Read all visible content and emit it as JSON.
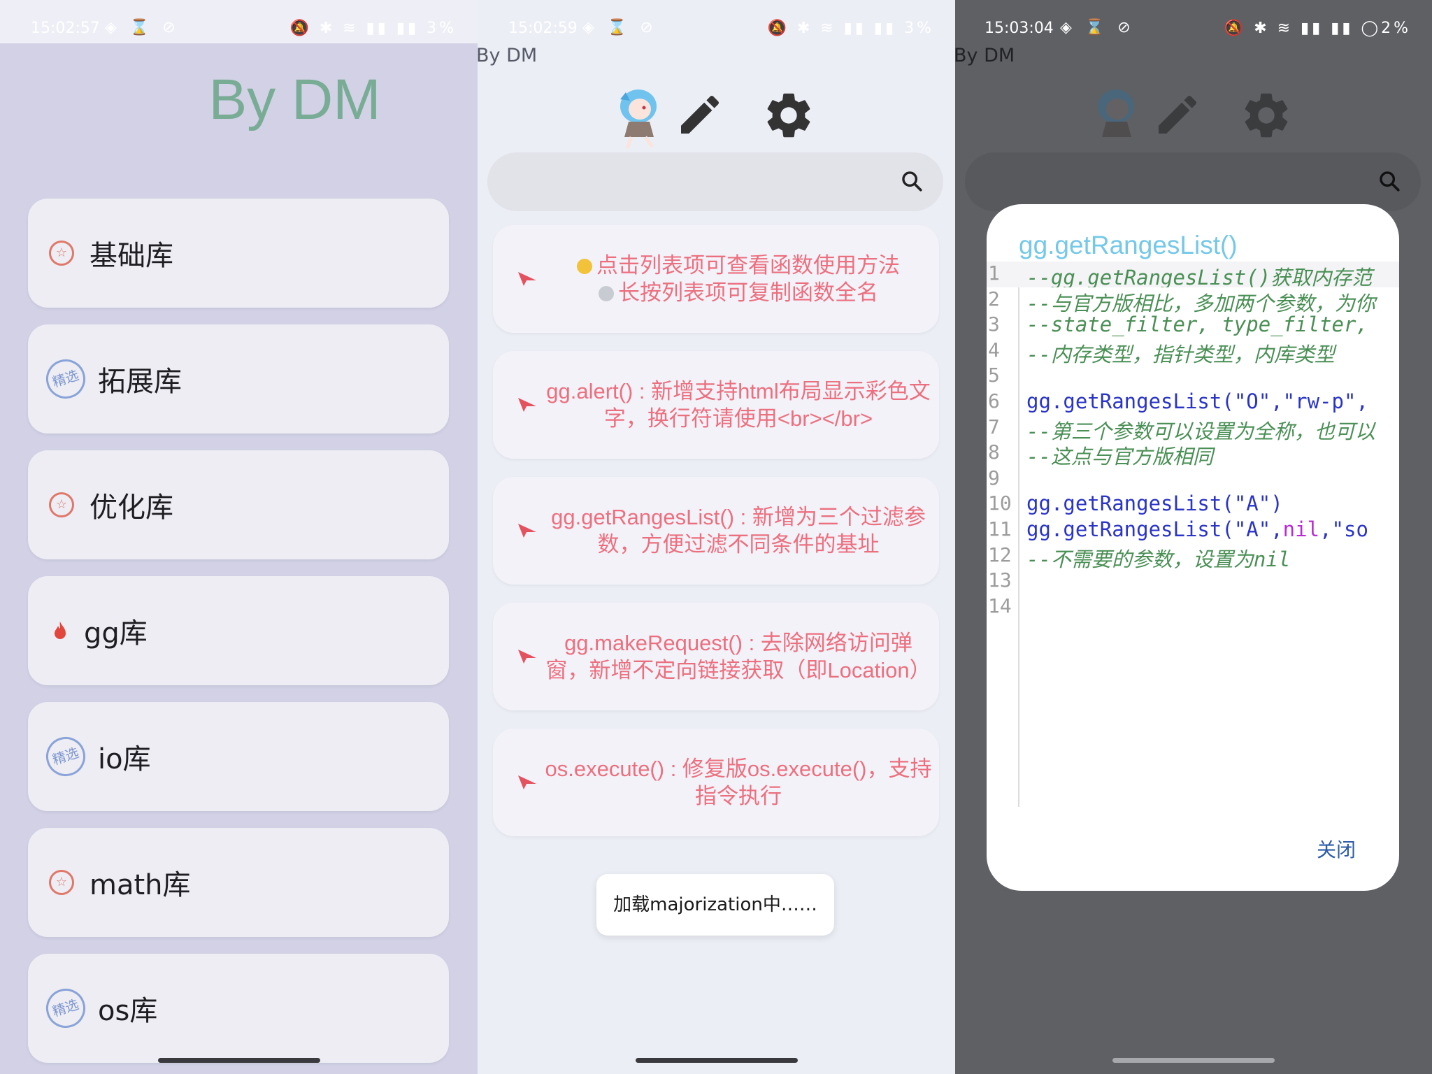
{
  "panel1": {
    "status": {
      "time": "15:02:57",
      "right": "3%"
    },
    "drawer_title": "By DM",
    "items": [
      {
        "label": "基础库",
        "icon": "award-badge-icon",
        "badge_text": "☆"
      },
      {
        "label": "拓展库",
        "icon": "featured-stamp-icon",
        "badge_text": "精选"
      },
      {
        "label": "优化库",
        "icon": "award-badge-icon",
        "badge_text": "☆"
      },
      {
        "label": "gg库",
        "icon": "fire-icon",
        "badge_text": ""
      },
      {
        "label": "io库",
        "icon": "featured-stamp-icon",
        "badge_text": "精选"
      },
      {
        "label": "math库",
        "icon": "award-badge-icon",
        "badge_text": "☆"
      },
      {
        "label": "os库",
        "icon": "featured-stamp-icon",
        "badge_text": "精选"
      }
    ]
  },
  "panel2": {
    "status": {
      "time": "15:02:59",
      "right": "3%"
    },
    "app_title": "By DM",
    "search_placeholder": "",
    "tips": [
      {
        "line1": "点击列表项可查看函数使用方法",
        "line2": "长按列表项可复制函数全名"
      },
      {
        "text": "gg.alert() : 新增支持html布局显示彩色文字，换行符请使用<br></br>"
      },
      {
        "text": "gg.getRangesList() : 新增为三个过滤参数，方便过滤不同条件的基址"
      },
      {
        "text": "gg.makeRequest() : 去除网络访问弹窗，新增不定向链接获取（即Location）"
      },
      {
        "text": "os.execute() : 修复版os.execute()，支持指令执行"
      }
    ],
    "toast": "加载majorization中……"
  },
  "panel3": {
    "status": {
      "time": "15:03:04",
      "right": "2%"
    },
    "app_title": "By DM",
    "dialog": {
      "title": "gg.getRangesList()",
      "close_label": "关闭",
      "line_numbers": [
        "1",
        "2",
        "3",
        "4",
        "5",
        "6",
        "7",
        "8",
        "9",
        "10",
        "11",
        "12",
        "13",
        "14"
      ],
      "lines": [
        "--gg.getRangesList()获取内存范",
        "--与官方版相比，多加两个参数，为你",
        "--state_filter, type_filter,",
        "--内存类型，指针类型，内库类型",
        "",
        "gg.getRangesList(\"O\",\"rw-p\",",
        "--第三个参数可以设置为全称，也可以",
        "--这点与官方版相同",
        "",
        "gg.getRangesList(\"A\")",
        "gg.getRangesList(\"A\",nil,\"so",
        "--不需要的参数，设置为nil",
        "",
        ""
      ]
    }
  },
  "colors": {
    "drawer_bg": "#d2d1e6",
    "title_green": "#79ac95",
    "tip_pink": "#ec6f7f",
    "dialog_title": "#74c8e8",
    "close_blue": "#2d5ba8"
  }
}
